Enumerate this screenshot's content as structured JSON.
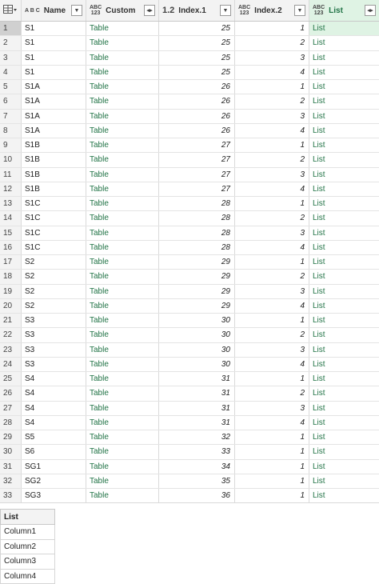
{
  "header": {
    "columns": [
      {
        "label": "Name",
        "type_icon": "ABC-text"
      },
      {
        "label": "Custom",
        "type_icon": "ABC 123"
      },
      {
        "label": "Index.1",
        "type_icon": "1.2"
      },
      {
        "label": "Index.2",
        "type_icon": "ABC 123"
      },
      {
        "label": "List",
        "type_icon": "ABC 123"
      }
    ],
    "type_labels": {
      "text": "A B C",
      "abc": "ABC",
      "n123": "123",
      "decimal": "1.2"
    }
  },
  "rows": [
    {
      "n": "1",
      "name": "S1",
      "custom": "Table",
      "i1": "25",
      "i2": "1",
      "list": "List"
    },
    {
      "n": "2",
      "name": "S1",
      "custom": "Table",
      "i1": "25",
      "i2": "2",
      "list": "List"
    },
    {
      "n": "3",
      "name": "S1",
      "custom": "Table",
      "i1": "25",
      "i2": "3",
      "list": "List"
    },
    {
      "n": "4",
      "name": "S1",
      "custom": "Table",
      "i1": "25",
      "i2": "4",
      "list": "List"
    },
    {
      "n": "5",
      "name": "S1A",
      "custom": "Table",
      "i1": "26",
      "i2": "1",
      "list": "List"
    },
    {
      "n": "6",
      "name": "S1A",
      "custom": "Table",
      "i1": "26",
      "i2": "2",
      "list": "List"
    },
    {
      "n": "7",
      "name": "S1A",
      "custom": "Table",
      "i1": "26",
      "i2": "3",
      "list": "List"
    },
    {
      "n": "8",
      "name": "S1A",
      "custom": "Table",
      "i1": "26",
      "i2": "4",
      "list": "List"
    },
    {
      "n": "9",
      "name": "S1B",
      "custom": "Table",
      "i1": "27",
      "i2": "1",
      "list": "List"
    },
    {
      "n": "10",
      "name": "S1B",
      "custom": "Table",
      "i1": "27",
      "i2": "2",
      "list": "List"
    },
    {
      "n": "11",
      "name": "S1B",
      "custom": "Table",
      "i1": "27",
      "i2": "3",
      "list": "List"
    },
    {
      "n": "12",
      "name": "S1B",
      "custom": "Table",
      "i1": "27",
      "i2": "4",
      "list": "List"
    },
    {
      "n": "13",
      "name": "S1C",
      "custom": "Table",
      "i1": "28",
      "i2": "1",
      "list": "List"
    },
    {
      "n": "14",
      "name": "S1C",
      "custom": "Table",
      "i1": "28",
      "i2": "2",
      "list": "List"
    },
    {
      "n": "15",
      "name": "S1C",
      "custom": "Table",
      "i1": "28",
      "i2": "3",
      "list": "List"
    },
    {
      "n": "16",
      "name": "S1C",
      "custom": "Table",
      "i1": "28",
      "i2": "4",
      "list": "List"
    },
    {
      "n": "17",
      "name": "S2",
      "custom": "Table",
      "i1": "29",
      "i2": "1",
      "list": "List"
    },
    {
      "n": "18",
      "name": "S2",
      "custom": "Table",
      "i1": "29",
      "i2": "2",
      "list": "List"
    },
    {
      "n": "19",
      "name": "S2",
      "custom": "Table",
      "i1": "29",
      "i2": "3",
      "list": "List"
    },
    {
      "n": "20",
      "name": "S2",
      "custom": "Table",
      "i1": "29",
      "i2": "4",
      "list": "List"
    },
    {
      "n": "21",
      "name": "S3",
      "custom": "Table",
      "i1": "30",
      "i2": "1",
      "list": "List"
    },
    {
      "n": "22",
      "name": "S3",
      "custom": "Table",
      "i1": "30",
      "i2": "2",
      "list": "List"
    },
    {
      "n": "23",
      "name": "S3",
      "custom": "Table",
      "i1": "30",
      "i2": "3",
      "list": "List"
    },
    {
      "n": "24",
      "name": "S3",
      "custom": "Table",
      "i1": "30",
      "i2": "4",
      "list": "List"
    },
    {
      "n": "25",
      "name": "S4",
      "custom": "Table",
      "i1": "31",
      "i2": "1",
      "list": "List"
    },
    {
      "n": "26",
      "name": "S4",
      "custom": "Table",
      "i1": "31",
      "i2": "2",
      "list": "List"
    },
    {
      "n": "27",
      "name": "S4",
      "custom": "Table",
      "i1": "31",
      "i2": "3",
      "list": "List"
    },
    {
      "n": "28",
      "name": "S4",
      "custom": "Table",
      "i1": "31",
      "i2": "4",
      "list": "List"
    },
    {
      "n": "29",
      "name": "S5",
      "custom": "Table",
      "i1": "32",
      "i2": "1",
      "list": "List"
    },
    {
      "n": "30",
      "name": "S6",
      "custom": "Table",
      "i1": "33",
      "i2": "1",
      "list": "List"
    },
    {
      "n": "31",
      "name": "SG1",
      "custom": "Table",
      "i1": "34",
      "i2": "1",
      "list": "List"
    },
    {
      "n": "32",
      "name": "SG2",
      "custom": "Table",
      "i1": "35",
      "i2": "1",
      "list": "List"
    },
    {
      "n": "33",
      "name": "SG3",
      "custom": "Table",
      "i1": "36",
      "i2": "1",
      "list": "List"
    }
  ],
  "preview": {
    "header": "List",
    "items": [
      "Column1",
      "Column2",
      "Column3",
      "Column4"
    ]
  }
}
